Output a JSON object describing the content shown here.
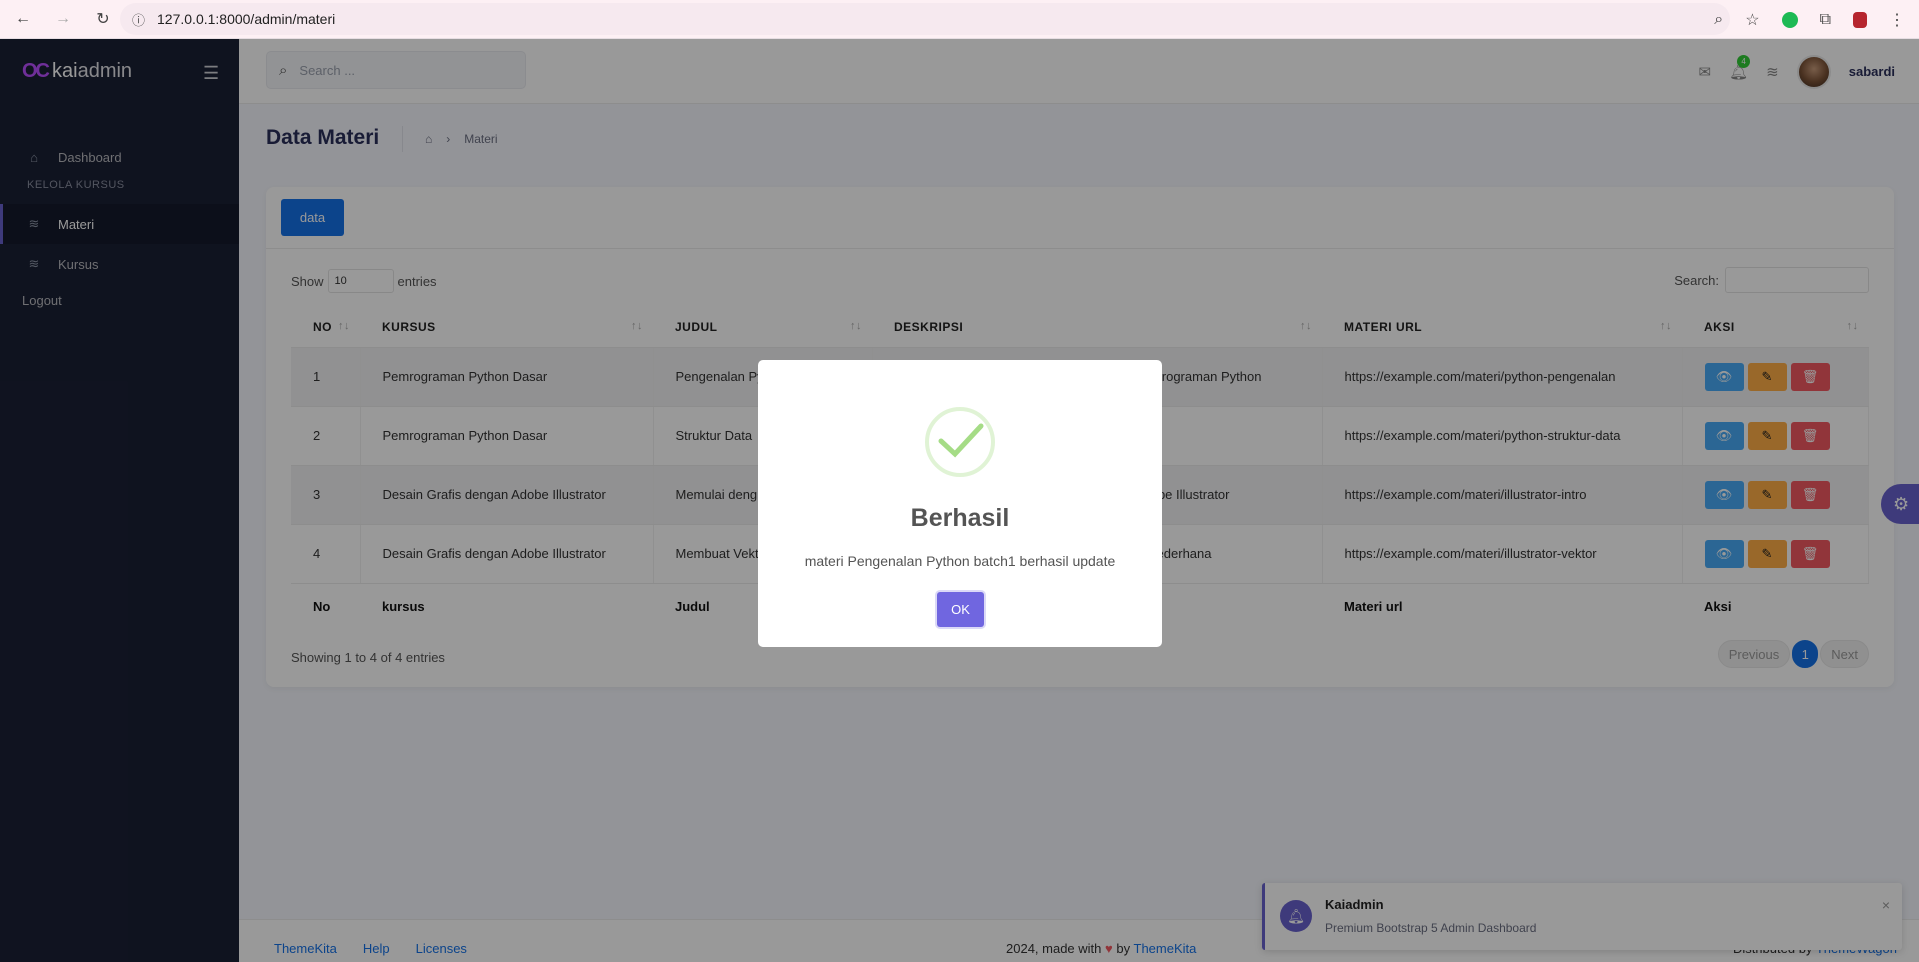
{
  "browser": {
    "url": "127.0.0.1:8000/admin/materi"
  },
  "sidebar": {
    "brand_mark": "OC",
    "brand_a": "kai",
    "brand_b": "admin",
    "items": [
      {
        "label": "Dashboard"
      },
      {
        "label": "Materi"
      },
      {
        "label": "Kursus"
      }
    ],
    "section": "KELOLA KURSUS",
    "logout": "Logout"
  },
  "topbar": {
    "search_placeholder": "Search ...",
    "notif_count": "4",
    "username": "sabardi"
  },
  "page": {
    "title": "Data Materi",
    "breadcrumb": "Materi"
  },
  "card": {
    "data_button": "data",
    "show_label": "Show",
    "show_value": "10",
    "entries_label": "entries",
    "search_label": "Search:",
    "headers": [
      "NO",
      "KURSUS",
      "JUDUL",
      "DESKRIPSI",
      "MATERI URL",
      "AKSI"
    ],
    "rows": [
      {
        "no": "1",
        "kursus": "Pemrograman Python Dasar",
        "judul": "Pengenalan Py",
        "deskripsi": "rograman Python",
        "url": "https://example.com/materi/python-pengenalan"
      },
      {
        "no": "2",
        "kursus": "Pemrograman Python Dasar",
        "judul": "Struktur Data",
        "deskripsi": "n",
        "url": "https://example.com/materi/python-struktur-data"
      },
      {
        "no": "3",
        "kursus": "Desain Grafis dengan Adobe Illustrator",
        "judul": "Memulai deng",
        "deskripsi": "be Illustrator",
        "url": "https://example.com/materi/illustrator-intro"
      },
      {
        "no": "4",
        "kursus": "Desain Grafis dengan Adobe Illustrator",
        "judul": "Membuat Vekt",
        "deskripsi": "ederhana",
        "url": "https://example.com/materi/illustrator-vektor"
      }
    ],
    "footer": [
      "No",
      "kursus",
      "Judul",
      "",
      "Materi url",
      "Aksi"
    ],
    "showing": "Showing 1 to 4 of 4 entries",
    "prev": "Previous",
    "page": "1",
    "next": "Next"
  },
  "footer": {
    "links": [
      "ThemeKita",
      "Help",
      "Licenses"
    ],
    "made_prefix": "2024, made with",
    "made_by": "by",
    "made_brand": "ThemeKita",
    "dist_prefix": "Distributed by",
    "dist_brand": "ThemeWagon"
  },
  "toast": {
    "title": "Kaiadmin",
    "message": "Premium Bootstrap 5 Admin Dashboard"
  },
  "modal": {
    "title": "Berhasil",
    "message": "materi Pengenalan Python batch1 berhasil update",
    "ok": "OK"
  },
  "colors": {
    "primary": "#1572e8",
    "secondary": "#6861ce",
    "success": "#31ce36",
    "danger": "#f25961",
    "warning": "#ffad46",
    "info": "#48abf7"
  }
}
